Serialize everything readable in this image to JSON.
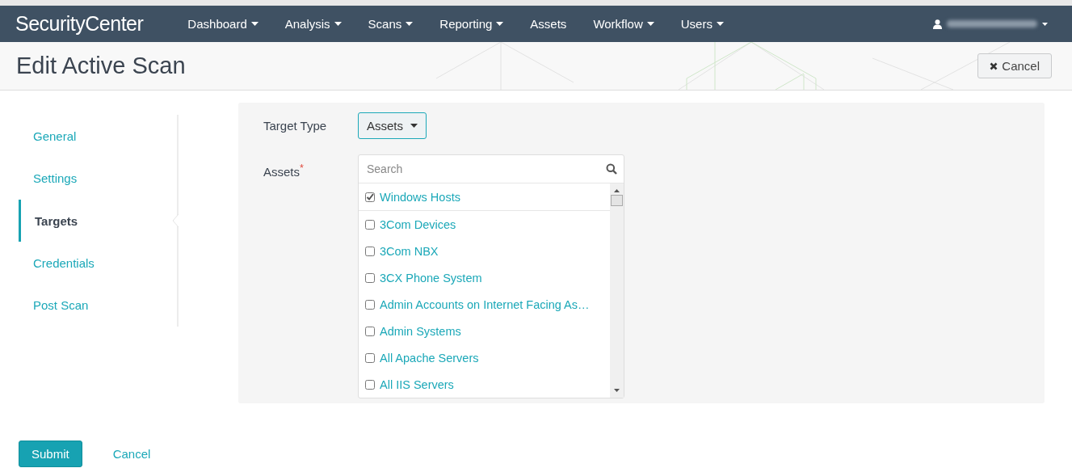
{
  "brand": "SecurityCenter",
  "nav": [
    {
      "label": "Dashboard",
      "dropdown": true
    },
    {
      "label": "Analysis",
      "dropdown": true
    },
    {
      "label": "Scans",
      "dropdown": true
    },
    {
      "label": "Reporting",
      "dropdown": true
    },
    {
      "label": "Assets",
      "dropdown": false
    },
    {
      "label": "Workflow",
      "dropdown": true
    },
    {
      "label": "Users",
      "dropdown": true
    }
  ],
  "page_title": "Edit Active Scan",
  "header_cancel": "Cancel",
  "steps": [
    {
      "label": "General",
      "selected": false
    },
    {
      "label": "Settings",
      "selected": false
    },
    {
      "label": "Targets",
      "selected": true
    },
    {
      "label": "Credentials",
      "selected": false
    },
    {
      "label": "Post Scan",
      "selected": false
    }
  ],
  "target_type": {
    "label": "Target Type",
    "value": "Assets"
  },
  "assets": {
    "label": "Assets",
    "required_mark": "*",
    "search": {
      "placeholder": "Search"
    },
    "items": [
      {
        "label": "Windows Hosts",
        "checked": true
      },
      {
        "label": "3Com Devices",
        "checked": false
      },
      {
        "label": "3Com NBX",
        "checked": false
      },
      {
        "label": "3CX Phone System",
        "checked": false
      },
      {
        "label": "Admin Accounts on Internet Facing As…",
        "checked": false
      },
      {
        "label": "Admin Systems",
        "checked": false
      },
      {
        "label": "All Apache Servers",
        "checked": false
      },
      {
        "label": "All IIS Servers",
        "checked": false
      }
    ]
  },
  "submit": "Submit",
  "cancel": "Cancel"
}
